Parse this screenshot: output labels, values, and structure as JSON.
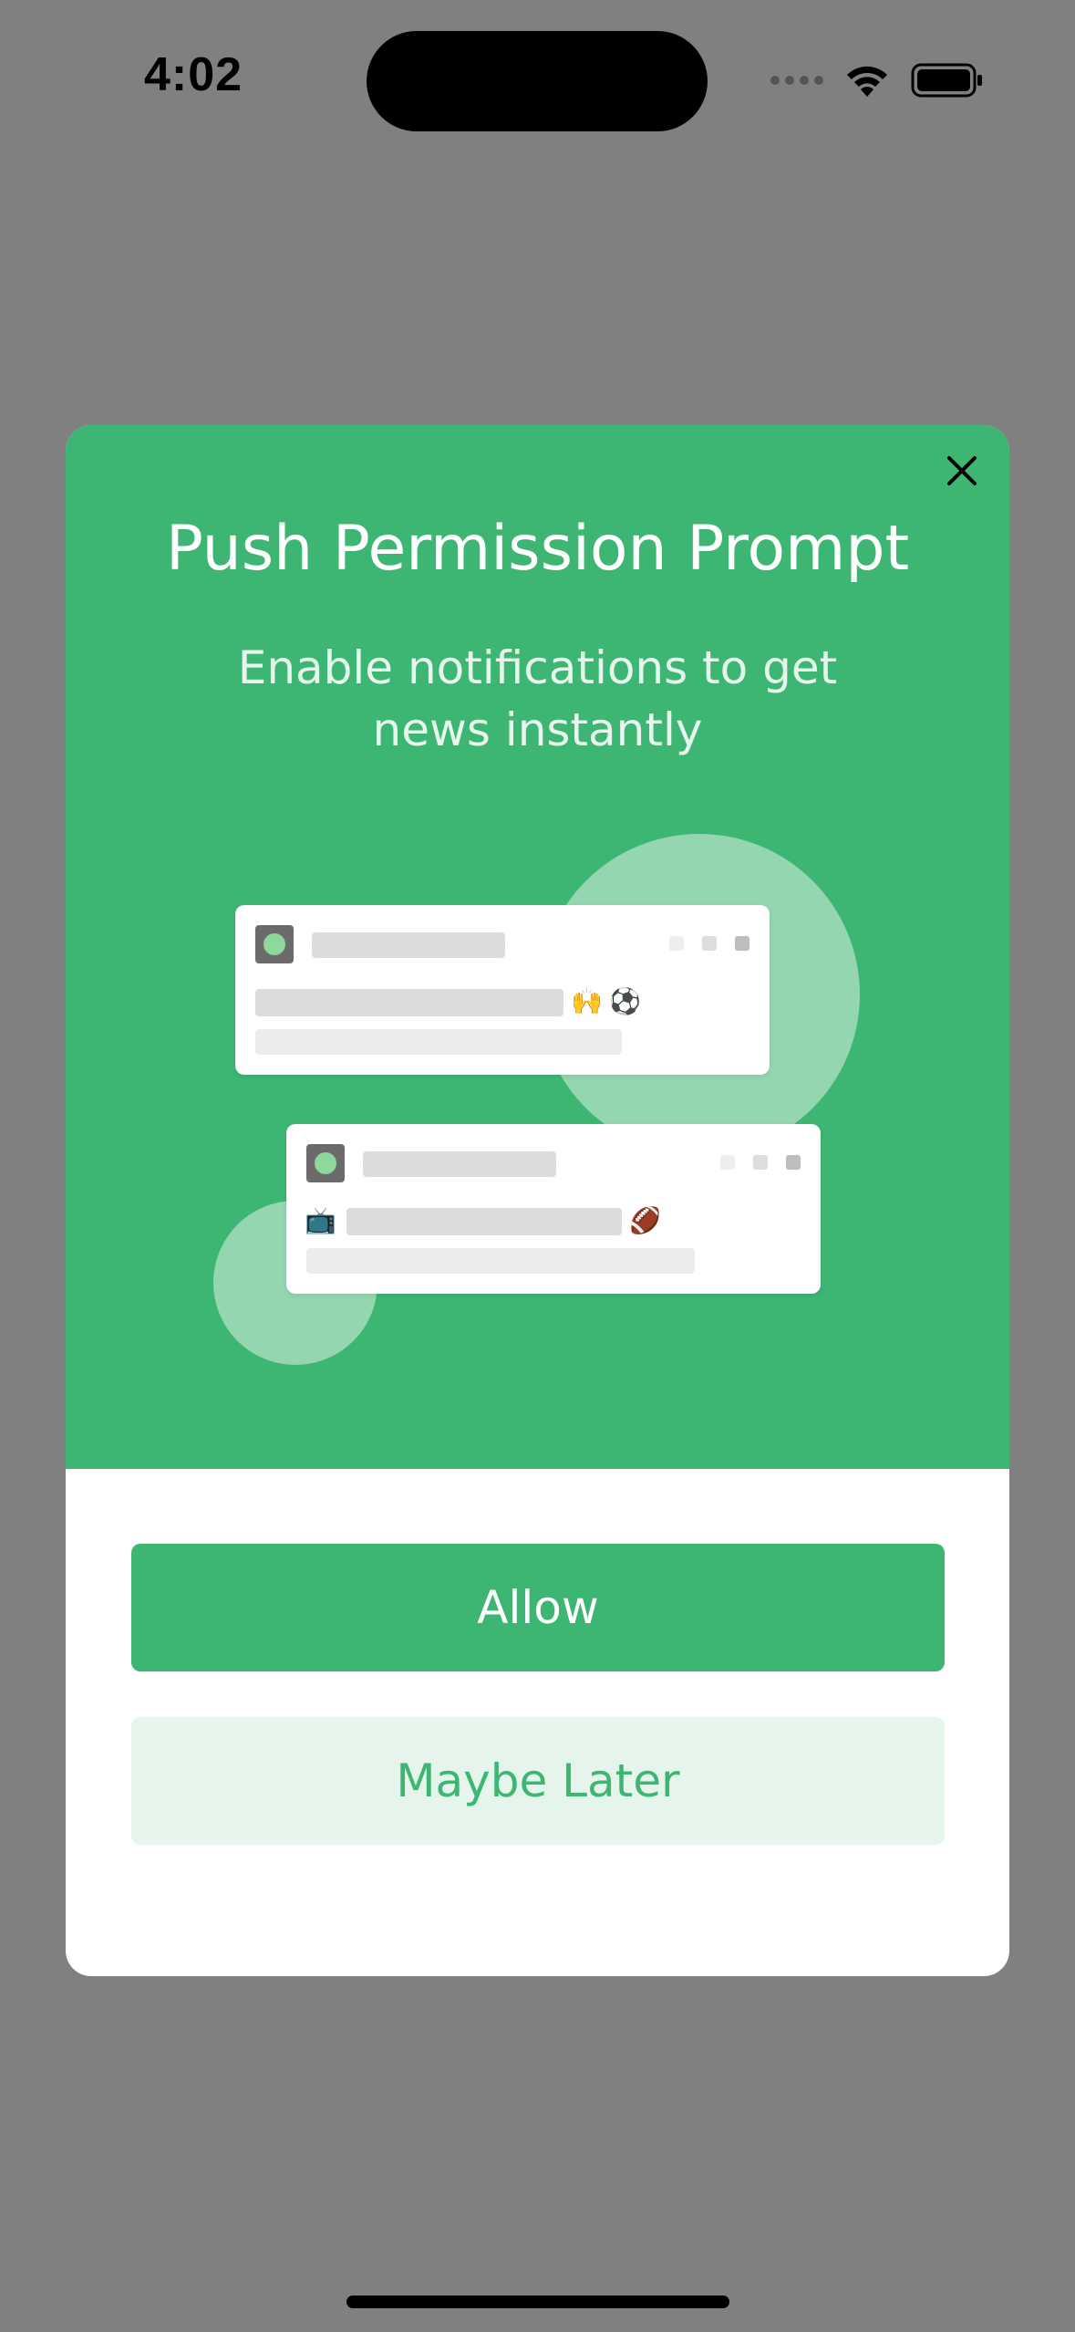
{
  "status_bar": {
    "time": "4:02"
  },
  "modal": {
    "title": "Push Permission Prompt",
    "subtitle": "Enable notifications to get news instantly",
    "close_icon": "close-icon",
    "preview_cards": [
      {
        "emojis": [
          "🙌",
          "⚽"
        ]
      },
      {
        "emojis": [
          "📺",
          "🏈"
        ]
      }
    ],
    "allow_label": "Allow",
    "maybe_later_label": "Maybe Later"
  },
  "colors": {
    "accent": "#3db673",
    "accent_light": "#e6f5ec",
    "overlay": "#808080",
    "circle": "#94d6b0"
  }
}
